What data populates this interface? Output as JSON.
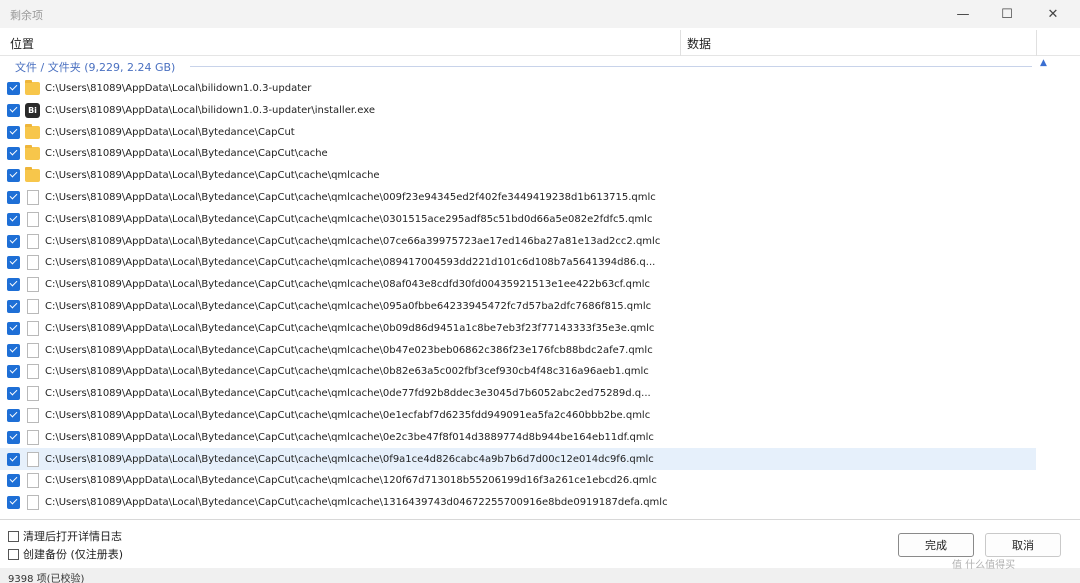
{
  "window": {
    "title": "剩余项",
    "min": "—",
    "max": "☐",
    "close": "✕"
  },
  "columns": {
    "location": "位置",
    "data": "数据"
  },
  "group": {
    "label": "文件 / 文件夹 (9,229, 2.24 GB)"
  },
  "rows": [
    {
      "icon": "folder",
      "path": "C:\\Users\\81089\\AppData\\Local\\bilidown1.0.3-updater"
    },
    {
      "icon": "exe",
      "path": "C:\\Users\\81089\\AppData\\Local\\bilidown1.0.3-updater\\installer.exe"
    },
    {
      "icon": "folder",
      "path": "C:\\Users\\81089\\AppData\\Local\\Bytedance\\CapCut"
    },
    {
      "icon": "folder",
      "path": "C:\\Users\\81089\\AppData\\Local\\Bytedance\\CapCut\\cache"
    },
    {
      "icon": "folder",
      "path": "C:\\Users\\81089\\AppData\\Local\\Bytedance\\CapCut\\cache\\qmlcache"
    },
    {
      "icon": "file",
      "path": "C:\\Users\\81089\\AppData\\Local\\Bytedance\\CapCut\\cache\\qmlcache\\009f23e94345ed2f402fe3449419238d1b613715.qmlc"
    },
    {
      "icon": "file",
      "path": "C:\\Users\\81089\\AppData\\Local\\Bytedance\\CapCut\\cache\\qmlcache\\0301515ace295adf85c51bd0d66a5e082e2fdfc5.qmlc"
    },
    {
      "icon": "file",
      "path": "C:\\Users\\81089\\AppData\\Local\\Bytedance\\CapCut\\cache\\qmlcache\\07ce66a39975723ae17ed146ba27a81e13ad2cc2.qmlc"
    },
    {
      "icon": "file",
      "path": "C:\\Users\\81089\\AppData\\Local\\Bytedance\\CapCut\\cache\\qmlcache\\089417004593dd221d101c6d108b7a5641394d86.q..."
    },
    {
      "icon": "file",
      "path": "C:\\Users\\81089\\AppData\\Local\\Bytedance\\CapCut\\cache\\qmlcache\\08af043e8cdfd30fd00435921513e1ee422b63cf.qmlc"
    },
    {
      "icon": "file",
      "path": "C:\\Users\\81089\\AppData\\Local\\Bytedance\\CapCut\\cache\\qmlcache\\095a0fbbe64233945472fc7d57ba2dfc7686f815.qmlc"
    },
    {
      "icon": "file",
      "path": "C:\\Users\\81089\\AppData\\Local\\Bytedance\\CapCut\\cache\\qmlcache\\0b09d86d9451a1c8be7eb3f23f77143333f35e3e.qmlc"
    },
    {
      "icon": "file",
      "path": "C:\\Users\\81089\\AppData\\Local\\Bytedance\\CapCut\\cache\\qmlcache\\0b47e023beb06862c386f23e176fcb88bdc2afe7.qmlc"
    },
    {
      "icon": "file",
      "path": "C:\\Users\\81089\\AppData\\Local\\Bytedance\\CapCut\\cache\\qmlcache\\0b82e63a5c002fbf3cef930cb4f48c316a96aeb1.qmlc"
    },
    {
      "icon": "file",
      "path": "C:\\Users\\81089\\AppData\\Local\\Bytedance\\CapCut\\cache\\qmlcache\\0de77fd92b8ddec3e3045d7b6052abc2ed75289d.q..."
    },
    {
      "icon": "file",
      "path": "C:\\Users\\81089\\AppData\\Local\\Bytedance\\CapCut\\cache\\qmlcache\\0e1ecfabf7d6235fdd949091ea5fa2c460bbb2be.qmlc"
    },
    {
      "icon": "file",
      "path": "C:\\Users\\81089\\AppData\\Local\\Bytedance\\CapCut\\cache\\qmlcache\\0e2c3be47f8f014d3889774d8b944be164eb11df.qmlc"
    },
    {
      "icon": "file",
      "path": "C:\\Users\\81089\\AppData\\Local\\Bytedance\\CapCut\\cache\\qmlcache\\0f9a1ce4d826cabc4a9b7b6d7d00c12e014dc9f6.qmlc",
      "selected": true
    },
    {
      "icon": "file",
      "path": "C:\\Users\\81089\\AppData\\Local\\Bytedance\\CapCut\\cache\\qmlcache\\120f67d713018b55206199d16f3a261ce1ebcd26.qmlc"
    },
    {
      "icon": "file",
      "path": "C:\\Users\\81089\\AppData\\Local\\Bytedance\\CapCut\\cache\\qmlcache\\1316439743d04672255700916e8bde0919187defa.qmlc"
    }
  ],
  "options": {
    "open_log": "清理后打开详情日志",
    "create_backup": "创建备份 (仅注册表)"
  },
  "buttons": {
    "done": "完成",
    "cancel": "取消"
  },
  "status": {
    "text": "9398 项(已校验)"
  },
  "watermark": "值 什么值得买",
  "colors": {
    "accent": "#1e6fd6",
    "group_text": "#4a70c0",
    "selected_row": "#e6f0fb"
  }
}
